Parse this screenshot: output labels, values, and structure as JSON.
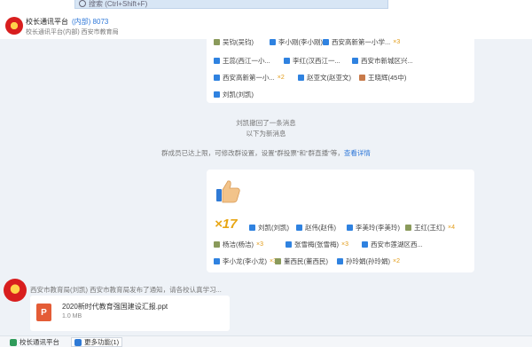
{
  "search": {
    "placeholder": "搜索 (Ctrl+Shift+F)"
  },
  "contact": {
    "name": "校长通讯平台",
    "tag": "(内部) 8073",
    "sub": "校长通讯平台(内部) 西安市教育局"
  },
  "members": [
    {
      "row": 0,
      "items": [
        {
          "name": "吴钧(吴钧)",
          "mult": ""
        },
        {
          "name": "李小刚(李小刚)",
          "mult": ""
        },
        {
          "name": "西安高新第一小学...",
          "mult": "×3"
        }
      ]
    },
    {
      "row": 1,
      "items": [
        {
          "name": "王蕊(西江一小...",
          "mult": ""
        },
        {
          "name": "李红(汉西江一...",
          "mult": ""
        },
        {
          "name": "西安市新城区兴...",
          "mult": ""
        }
      ]
    },
    {
      "row": 2,
      "items": [
        {
          "name": "西安高新第一小...",
          "mult": "×2"
        },
        {
          "name": "赵亚文(赵亚文)",
          "mult": ""
        },
        {
          "name": "王晓辉(45中)",
          "mult": ""
        }
      ]
    },
    {
      "row": 3,
      "items": [
        {
          "name": "刘凯(刘凯)",
          "mult": ""
        }
      ]
    }
  ],
  "system": {
    "line1": "刘凯撤回了一条消息",
    "line2": "以下为新消息",
    "note_prefix": "群成员已达上限，可修改群设置，设置\"群投票\"和\"群直播\"等，",
    "note_link": "查看详情"
  },
  "like": {
    "count": "×17",
    "members": [
      {
        "name": "刘凯(刘凯)",
        "mult": ""
      },
      {
        "name": "赵伟(赵伟)",
        "mult": ""
      },
      {
        "name": "李美玲(李美玲)",
        "mult": ""
      },
      {
        "name": "王红(王红)",
        "mult": "×4"
      },
      {
        "name": "杨洁(杨洁)",
        "mult": "×3"
      },
      {
        "name": "张雪梅(张雪梅)",
        "mult": "×3"
      },
      {
        "name": "西安市莲湖区西...",
        "mult": ""
      },
      {
        "name": "李小龙(李小龙)",
        "mult": "×3"
      },
      {
        "name": "董西民(董西民)",
        "mult": ""
      },
      {
        "name": "孙玲娟(孙玲娟)",
        "mult": "×2"
      }
    ]
  },
  "message": {
    "sender": "西安市教育局(刘凯)      西安市教育局发布了通知，请各校认真学习...",
    "file_icon": "P",
    "file_name": "2020新时代教育强国建设汇报.ppt",
    "file_size": "1.0 MB"
  },
  "toolbar": {
    "left": "校长通讯平台",
    "right": "更多功能(1)"
  },
  "colors": {
    "accent": "#2d77d8",
    "like": "#e8a614",
    "ppt": "#e45c36"
  }
}
